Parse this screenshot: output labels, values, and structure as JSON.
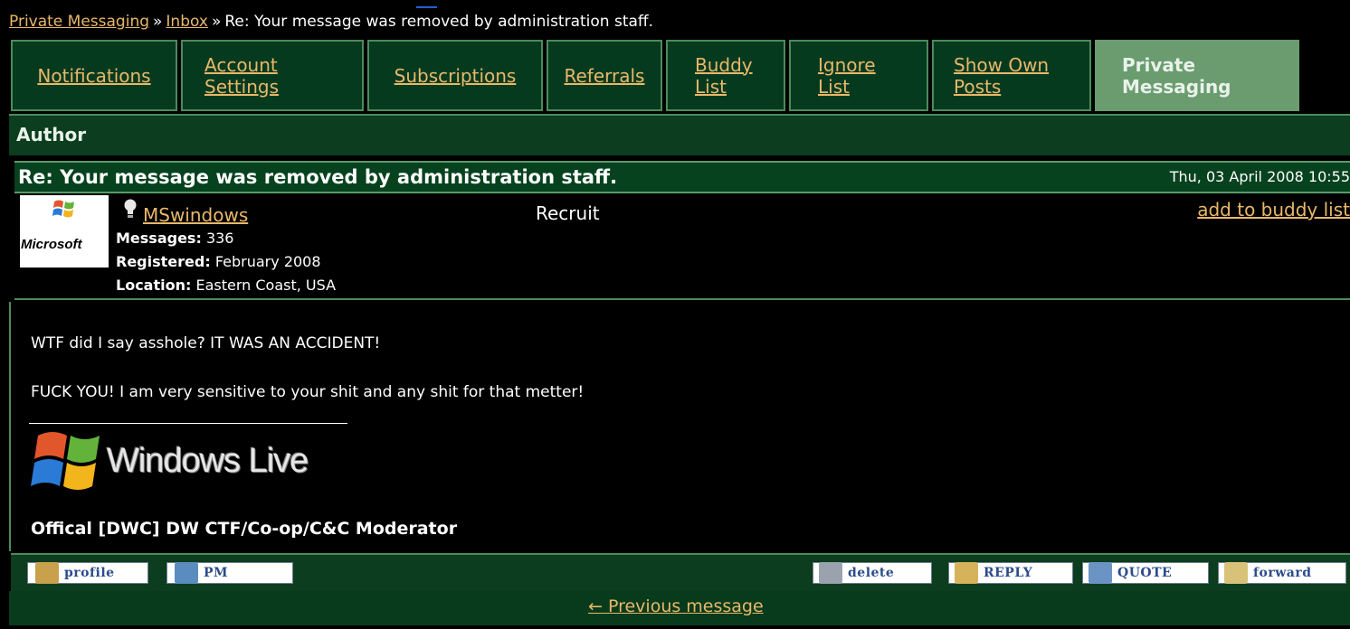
{
  "breadcrumb": {
    "private_messaging": "Private Messaging",
    "sep1": "»",
    "inbox": "Inbox",
    "sep2": "»",
    "current": "Re: Your message was removed by administration staff."
  },
  "tabs": [
    {
      "label": "Notifications"
    },
    {
      "label": "Account Settings"
    },
    {
      "label": "Subscriptions"
    },
    {
      "label": "Referrals"
    },
    {
      "label": "Buddy List"
    },
    {
      "label": "Ignore List"
    },
    {
      "label": "Show Own Posts"
    },
    {
      "label": "Private Messaging",
      "active": true
    }
  ],
  "author_header": "Author",
  "message": {
    "subject": "Re: Your message was removed by administration staff.",
    "date": "Thu, 03 April 2008 10:55",
    "avatar_text": "Microsoft",
    "username": "MSwindows",
    "rank": "Recruit",
    "add_buddy": "add to buddy list",
    "stats": {
      "messages_label": "Messages:",
      "messages_value": "336",
      "registered_label": "Registered:",
      "registered_value": "February 2008",
      "location_label": "Location:",
      "location_value": "Eastern Coast, USA"
    },
    "body_lines": [
      "WTF did I say asshole? IT WAS AN ACCIDENT!",
      "FUCK YOU! I am very sensitive to your shit and any shit for that metter!"
    ],
    "signature": {
      "logo_text": "Windows Live",
      "role": "Offical [DWC] DW CTF/Co-op/C&C Moderator"
    }
  },
  "actions": {
    "profile": "profile",
    "pm": "PM",
    "delete": "delete",
    "reply": "REPLY",
    "quote": "QUOTE",
    "forward": "forward"
  },
  "footer": {
    "previous": "← Previous message"
  },
  "colors": {
    "tab_bg": "#063a1f",
    "tab_active": "#6a9c6f",
    "link": "#e8b86a",
    "border": "#4d8a5b"
  }
}
